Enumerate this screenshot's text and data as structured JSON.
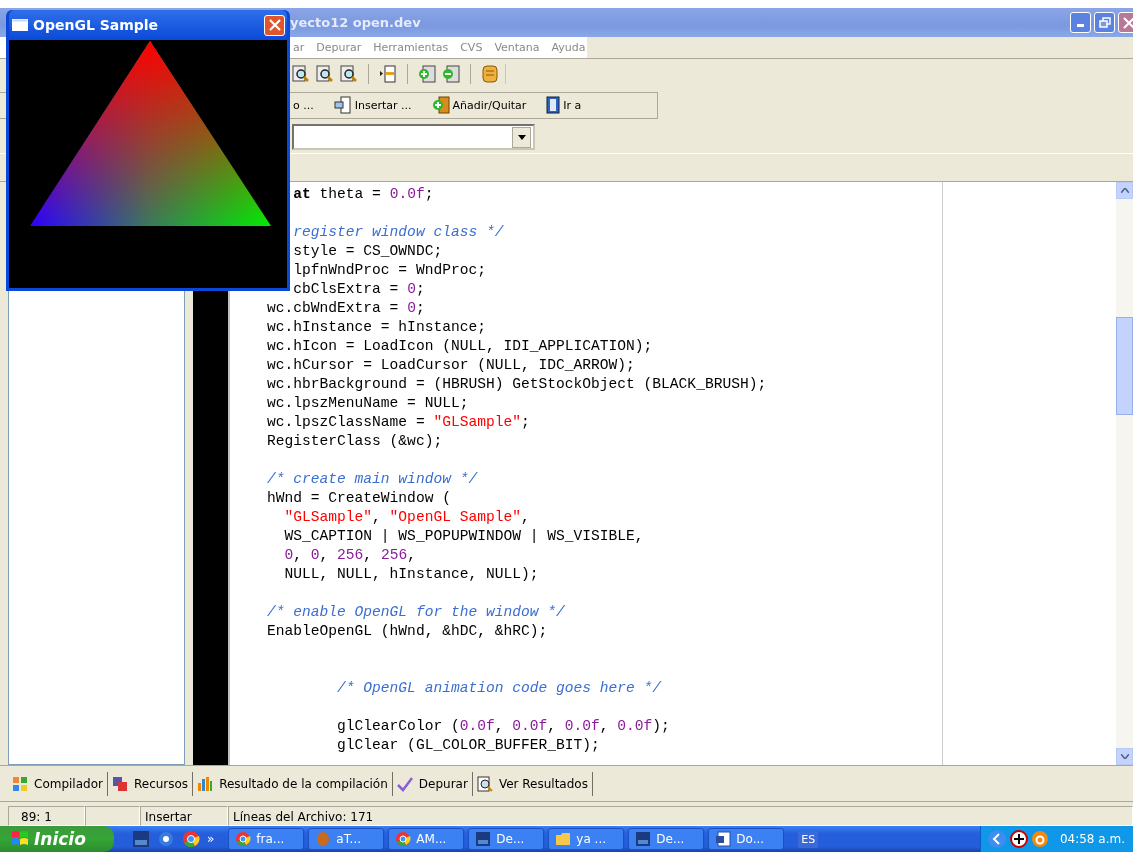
{
  "gl_window": {
    "title": "OpenGL Sample"
  },
  "ide": {
    "title": "yecto12 open.dev",
    "menu": [
      {
        "label": "ar"
      },
      {
        "label": "Depurar"
      },
      {
        "label": "Herramientas"
      },
      {
        "label": "CVS"
      },
      {
        "label": "Ventana"
      },
      {
        "label": "Ayuda"
      }
    ],
    "toolbar2": [
      {
        "label": "o ...",
        "kind": "none"
      },
      {
        "label": "Insertar ...",
        "kind": "insert"
      },
      {
        "label": "Añadir/Quitar",
        "kind": "add"
      },
      {
        "label": "Ir a",
        "kind": "goto"
      }
    ],
    "code_lines": [
      {
        "tokens": [
          {
            "kind": "keyword",
            "text": "   at"
          },
          {
            "kind": "plain",
            "text": " theta = "
          },
          {
            "kind": "number",
            "text": "0.0f"
          },
          {
            "kind": "plain",
            "text": ";"
          }
        ]
      },
      {
        "kind": "blank"
      },
      {
        "tokens": [
          {
            "kind": "comment",
            "text": "   register window class */"
          }
        ]
      },
      {
        "tokens": [
          {
            "kind": "plain",
            "text": "   style = CS_OWNDC;"
          }
        ]
      },
      {
        "tokens": [
          {
            "kind": "plain",
            "text": "   lpfnWndProc = WndProc;"
          }
        ]
      },
      {
        "tokens": [
          {
            "kind": "plain",
            "text": "   cbClsExtra = "
          },
          {
            "kind": "number",
            "text": "0"
          },
          {
            "kind": "plain",
            "text": ";"
          }
        ]
      },
      {
        "tokens": [
          {
            "kind": "plain",
            "text": "wc.cbWndExtra = "
          },
          {
            "kind": "number",
            "text": "0"
          },
          {
            "kind": "plain",
            "text": ";"
          }
        ]
      },
      {
        "tokens": [
          {
            "kind": "plain",
            "text": "wc.hInstance = hInstance;"
          }
        ]
      },
      {
        "tokens": [
          {
            "kind": "plain",
            "text": "wc.hIcon = LoadIcon (NULL, IDI_APPLICATION);"
          }
        ]
      },
      {
        "tokens": [
          {
            "kind": "plain",
            "text": "wc.hCursor = LoadCursor (NULL, IDC_ARROW);"
          }
        ]
      },
      {
        "tokens": [
          {
            "kind": "plain",
            "text": "wc.hbrBackground = (HBRUSH) GetStockObject (BLACK_BRUSH);"
          }
        ]
      },
      {
        "tokens": [
          {
            "kind": "plain",
            "text": "wc.lpszMenuName = NULL;"
          }
        ]
      },
      {
        "tokens": [
          {
            "kind": "plain",
            "text": "wc.lpszClassName = "
          },
          {
            "kind": "string",
            "text": "\"GLSample\""
          },
          {
            "kind": "plain",
            "text": ";"
          }
        ]
      },
      {
        "tokens": [
          {
            "kind": "plain",
            "text": "RegisterClass (&wc);"
          }
        ]
      },
      {
        "kind": "blank"
      },
      {
        "tokens": [
          {
            "kind": "comment",
            "text": "/* create main window */"
          }
        ]
      },
      {
        "tokens": [
          {
            "kind": "plain",
            "text": "hWnd = CreateWindow ("
          }
        ]
      },
      {
        "tokens": [
          {
            "kind": "string",
            "text": "  \"GLSample\""
          },
          {
            "kind": "plain",
            "text": ", "
          },
          {
            "kind": "string",
            "text": "\"OpenGL Sample\""
          },
          {
            "kind": "plain",
            "text": ","
          }
        ]
      },
      {
        "tokens": [
          {
            "kind": "plain",
            "text": "  WS_CAPTION | WS_POPUPWINDOW | WS_VISIBLE,"
          }
        ]
      },
      {
        "tokens": [
          {
            "kind": "number",
            "text": "  0"
          },
          {
            "kind": "plain",
            "text": ", "
          },
          {
            "kind": "number",
            "text": "0"
          },
          {
            "kind": "plain",
            "text": ", "
          },
          {
            "kind": "number",
            "text": "256"
          },
          {
            "kind": "plain",
            "text": ", "
          },
          {
            "kind": "number",
            "text": "256"
          },
          {
            "kind": "plain",
            "text": ","
          }
        ]
      },
      {
        "tokens": [
          {
            "kind": "plain",
            "text": "  NULL, NULL, hInstance, NULL);"
          }
        ]
      },
      {
        "kind": "blank"
      },
      {
        "tokens": [
          {
            "kind": "comment",
            "text": "/* enable OpenGL for the window */"
          }
        ]
      },
      {
        "tokens": [
          {
            "kind": "plain",
            "text": "EnableOpenGL (hWnd, &hDC, &hRC);"
          }
        ]
      },
      {
        "kind": "blank"
      },
      {
        "kind": "blank"
      },
      {
        "tokens": [
          {
            "kind": "comment",
            "text": "        /* OpenGL animation code goes here */"
          }
        ]
      },
      {
        "kind": "blank"
      },
      {
        "tokens": [
          {
            "kind": "plain",
            "text": "        glClearColor ("
          },
          {
            "kind": "number",
            "text": "0.0f"
          },
          {
            "kind": "plain",
            "text": ", "
          },
          {
            "kind": "number",
            "text": "0.0f"
          },
          {
            "kind": "plain",
            "text": ", "
          },
          {
            "kind": "number",
            "text": "0.0f"
          },
          {
            "kind": "plain",
            "text": ", "
          },
          {
            "kind": "number",
            "text": "0.0f"
          },
          {
            "kind": "plain",
            "text": ");"
          }
        ]
      },
      {
        "tokens": [
          {
            "kind": "plain",
            "text": "        glClear (GL_COLOR_BUFFER_BIT);"
          }
        ]
      }
    ],
    "bottom_tabs": [
      {
        "label": "Compilador",
        "kind": "compiler",
        "selected": false
      },
      {
        "label": "Recursos",
        "kind": "resources",
        "selected": false
      },
      {
        "label": "Resultado de la compilación",
        "kind": "results",
        "selected": false
      },
      {
        "label": "Depurar",
        "kind": "debug",
        "selected": false
      },
      {
        "label": "Ver Resultados",
        "kind": "view",
        "selected": false
      }
    ],
    "status_bar": [
      {
        "text": "89: 1"
      },
      {
        "text": "Insertar"
      },
      {
        "text": "Líneas del Archivo: 171"
      }
    ]
  },
  "taskbar": {
    "start": "Inicio",
    "more": "»",
    "tasks": [
      {
        "label": "fra...",
        "kind": "browser"
      },
      {
        "label": "aT...",
        "kind": "mitt"
      },
      {
        "label": "AM...",
        "kind": "browser"
      },
      {
        "label": "De...",
        "kind": "ide"
      },
      {
        "label": "ya ...",
        "kind": "folder"
      },
      {
        "label": "De...",
        "kind": "ide"
      },
      {
        "label": "Do...",
        "kind": "document"
      }
    ],
    "language": "ES",
    "clock": "04:58 a.m."
  }
}
